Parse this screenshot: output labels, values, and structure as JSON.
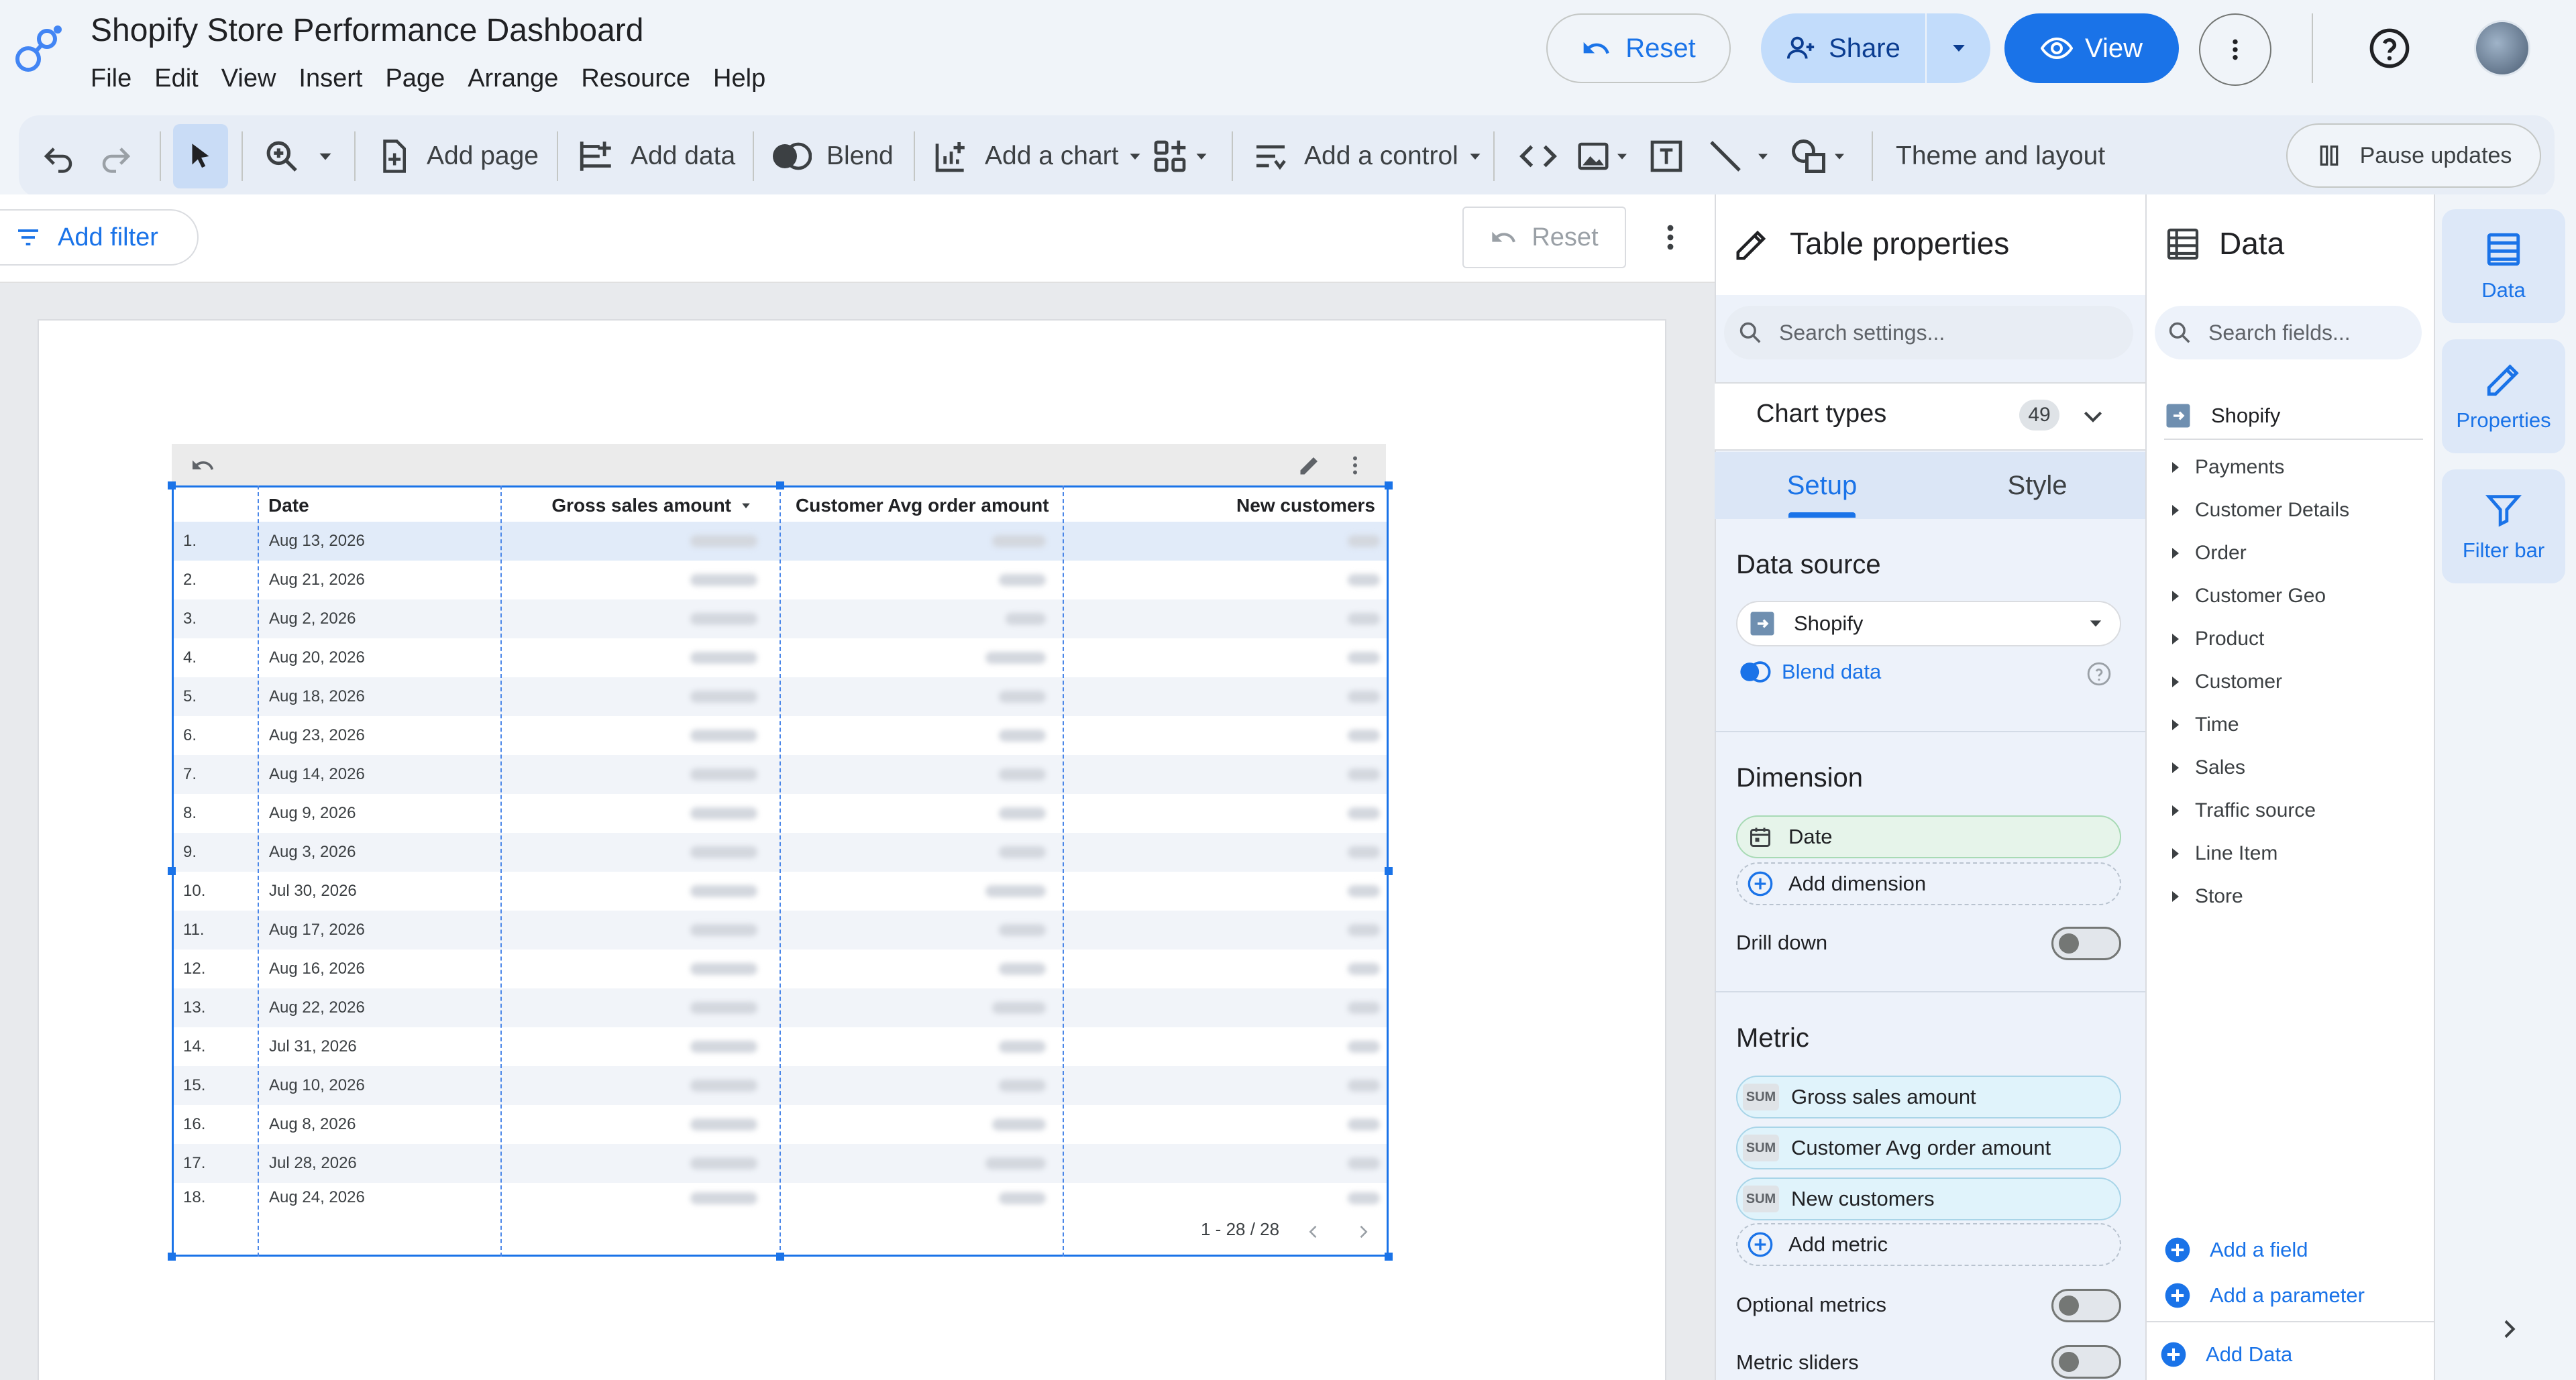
{
  "app": {
    "title": "Shopify Store Performance Dashboard",
    "menus": [
      "File",
      "Edit",
      "View",
      "Insert",
      "Page",
      "Arrange",
      "Resource",
      "Help"
    ],
    "reset_label": "Reset",
    "share_label": "Share",
    "view_label": "View"
  },
  "toolbar": {
    "add_page": "Add page",
    "add_data": "Add data",
    "blend": "Blend",
    "add_chart": "Add a chart",
    "add_control": "Add a control",
    "theme_layout": "Theme and layout",
    "pause_updates": "Pause updates"
  },
  "filterbar": {
    "add_filter": "Add filter",
    "reset": "Reset"
  },
  "table": {
    "columns": [
      "Date",
      "Gross sales amount",
      "Customer Avg order amount",
      "New customers"
    ],
    "sort_column": "Gross sales amount",
    "rows": [
      {
        "n": "1.",
        "date": "Aug 13, 2026"
      },
      {
        "n": "2.",
        "date": "Aug 21, 2026"
      },
      {
        "n": "3.",
        "date": "Aug 2, 2026"
      },
      {
        "n": "4.",
        "date": "Aug 20, 2026"
      },
      {
        "n": "5.",
        "date": "Aug 18, 2026"
      },
      {
        "n": "6.",
        "date": "Aug 23, 2026"
      },
      {
        "n": "7.",
        "date": "Aug 14, 2026"
      },
      {
        "n": "8.",
        "date": "Aug 9, 2026"
      },
      {
        "n": "9.",
        "date": "Aug 3, 2026"
      },
      {
        "n": "10.",
        "date": "Jul 30, 2026"
      },
      {
        "n": "11.",
        "date": "Aug 17, 2026"
      },
      {
        "n": "12.",
        "date": "Aug 16, 2026"
      },
      {
        "n": "13.",
        "date": "Aug 22, 2026"
      },
      {
        "n": "14.",
        "date": "Jul 31, 2026"
      },
      {
        "n": "15.",
        "date": "Aug 10, 2026"
      },
      {
        "n": "16.",
        "date": "Aug 8, 2026"
      },
      {
        "n": "17.",
        "date": "Jul 28, 2026"
      },
      {
        "n": "18.",
        "date": "Aug 24, 2026"
      }
    ],
    "pagination": "1 - 28 / 28"
  },
  "properties": {
    "title": "Table properties",
    "search_placeholder": "Search settings...",
    "chart_types_label": "Chart types",
    "chart_types_count": "49",
    "tab_setup": "Setup",
    "tab_style": "Style",
    "data_source_title": "Data source",
    "data_source_value": "Shopify",
    "blend_data": "Blend data",
    "dimension_title": "Dimension",
    "dimension_value": "Date",
    "add_dimension": "Add dimension",
    "drill_down": "Drill down",
    "metric_title": "Metric",
    "sum_tag": "SUM",
    "metrics": [
      "Gross sales amount",
      "Customer Avg order amount",
      "New customers"
    ],
    "add_metric": "Add metric",
    "optional_metrics": "Optional metrics",
    "metric_sliders": "Metric sliders"
  },
  "data_panel": {
    "title": "Data",
    "search_placeholder": "Search fields...",
    "source": "Shopify",
    "groups": [
      "Payments",
      "Customer Details",
      "Order",
      "Customer Geo",
      "Product",
      "Customer",
      "Time",
      "Sales",
      "Traffic source",
      "Line Item",
      "Store"
    ],
    "add_field": "Add a field",
    "add_parameter": "Add a parameter",
    "add_data": "Add Data"
  },
  "rail": {
    "data": "Data",
    "properties": "Properties",
    "filter_bar": "Filter bar"
  },
  "colors": {
    "accent": "#1a73e8",
    "header_bg": "#f0f4f9",
    "panel_bg": "#edf2fa"
  }
}
